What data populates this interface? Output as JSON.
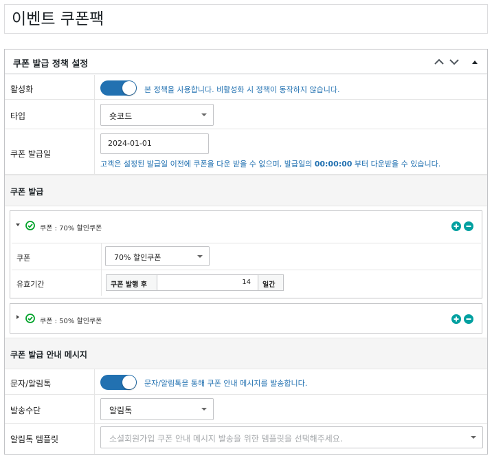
{
  "page": {
    "title": "이벤트 쿠폰팩"
  },
  "panel": {
    "title": "쿠폰 발급 정책 설정",
    "policy_rows": {
      "active": {
        "label": "활성화",
        "toggle_on": true,
        "desc": "본 정책을 사용합니다. 비활성화 시 정책이 동작하지 않습니다."
      },
      "type": {
        "label": "타입",
        "value": "숏코드"
      },
      "issue_date": {
        "label": "쿠폰 발급일",
        "value": "2024-01-01",
        "desc_prefix": "고객은 설정된 발급일 이전에 쿠폰을 다운 받을 수 없으며, 발급일의 ",
        "desc_time": "00:00:00",
        "desc_suffix": " 부터 다운받을 수 있습니다."
      }
    },
    "coupon_section": {
      "title": "쿠폰 발급",
      "coupons": [
        {
          "title": "쿠폰 : 70% 할인쿠폰",
          "expanded": true,
          "coupon_label": "쿠폰",
          "coupon_value": "70% 할인쿠폰",
          "period_label": "유효기간",
          "period_prefix": "쿠폰 발행 후",
          "period_value": "14",
          "period_suffix": "일간"
        },
        {
          "title": "쿠폰 : 50% 할인쿠폰",
          "expanded": false
        }
      ]
    },
    "message_section": {
      "title": "쿠폰 발급 안내 메시지",
      "sms": {
        "label": "문자/알림톡",
        "toggle_on": true,
        "desc": "문자/알림톡을 통해 쿠폰 안내 메시지를 발송합니다."
      },
      "method": {
        "label": "발송수단",
        "value": "알림톡"
      },
      "template": {
        "label": "알림톡 템플릿",
        "placeholder": "소셜회원가입 쿠폰 안내 메시지 발송을 위한 템플릿을 선택해주세요."
      }
    }
  },
  "colors": {
    "accent": "#2271b1",
    "success": "#00a32a",
    "teal": "#00a0a0"
  },
  "icons": [
    "chevron-up-icon",
    "chevron-down-icon",
    "collapse-triangle-icon",
    "check-circle-icon",
    "plus-circle-icon",
    "minus-circle-icon",
    "caret-down-icon"
  ]
}
